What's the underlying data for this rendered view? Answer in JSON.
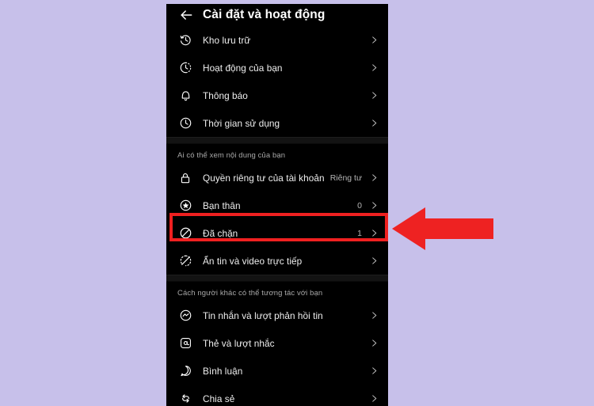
{
  "annotation": {
    "highlight_color": "#ef2020",
    "arrow_color": "#ee2222",
    "arrow_direction": "left",
    "highlighted_row_label": "Đã chặn"
  },
  "background_color": "#c7c0ea",
  "phone": {
    "screen_background": "#000000",
    "header": {
      "back_icon": "back-arrow-icon",
      "title": "Cài đặt và hoạt động"
    },
    "sections": [
      {
        "id": "top-section",
        "header": null,
        "rows": [
          {
            "icon": "archive-clock-icon",
            "label": "Kho lưu trữ",
            "value": "",
            "chevron": true
          },
          {
            "icon": "dashed-clock-icon",
            "label": "Hoạt động của bạn",
            "value": "",
            "chevron": true
          },
          {
            "icon": "bell-icon",
            "label": "Thông báo",
            "value": "",
            "chevron": true
          },
          {
            "icon": "clock-icon",
            "label": "Thời gian sử dụng",
            "value": "",
            "chevron": true
          }
        ]
      },
      {
        "id": "who-can-see",
        "header": "Ai có thể xem nội dung của bạn",
        "rows": [
          {
            "icon": "lock-icon",
            "label": "Quyền riêng tư của tài khoản",
            "value": "Riêng tư",
            "chevron": true
          },
          {
            "icon": "star-circle-icon",
            "label": "Bạn thân",
            "value": "0",
            "chevron": true
          },
          {
            "icon": "block-icon",
            "label": "Đã chặn",
            "value": "1",
            "chevron": true
          },
          {
            "icon": "hide-story-icon",
            "label": "Ẩn tin và video trực tiếp",
            "value": "",
            "chevron": true
          }
        ]
      },
      {
        "id": "how-others-interact",
        "header": "Cách người khác có thể tương tác với bạn",
        "rows": [
          {
            "icon": "messenger-icon",
            "label": "Tin nhắn và lượt phản hồi tin",
            "value": "",
            "chevron": true
          },
          {
            "icon": "at-mention-icon",
            "label": "Thẻ và lượt nhắc",
            "value": "",
            "chevron": true
          },
          {
            "icon": "comment-bubble-icon",
            "label": "Bình luận",
            "value": "",
            "chevron": true
          },
          {
            "icon": "share-repost-icon",
            "label": "Chia sẻ",
            "value": "",
            "chevron": true
          }
        ]
      }
    ]
  }
}
